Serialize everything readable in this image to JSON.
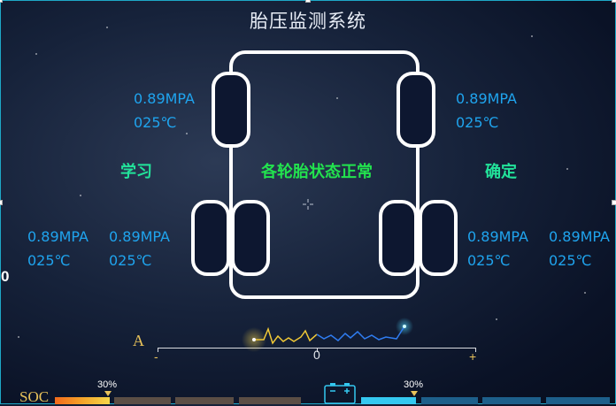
{
  "title": "胎压监测系统",
  "status": "各轮胎状态正常",
  "buttons": {
    "learn": "学习",
    "confirm": "确定"
  },
  "tires": {
    "front_left": {
      "pressure": "0.89MPA",
      "temp": "025℃"
    },
    "front_right": {
      "pressure": "0.89MPA",
      "temp": "025℃"
    },
    "rear_left_outer": {
      "pressure": "0.89MPA",
      "temp": "025℃"
    },
    "rear_left_inner": {
      "pressure": "0.89MPA",
      "temp": "025℃"
    },
    "rear_right_inner": {
      "pressure": "0.89MPA",
      "temp": "025℃"
    },
    "rear_right_outer": {
      "pressure": "0.89MPA",
      "temp": "025℃"
    }
  },
  "left_edge_digit": "0",
  "current_meter": {
    "label": "A",
    "minus": "-",
    "zero": "0",
    "plus": "+"
  },
  "soc": {
    "label": "SOC",
    "left_percent": "30%",
    "right_percent": "30%"
  },
  "colors": {
    "accent_cyan": "#1ea8c7",
    "reading_blue": "#1fa4ee",
    "status_green": "#22e34e",
    "button_green": "#22e39a",
    "gold": "#e8c25a"
  },
  "icons": [
    "crosshair-icon",
    "battery-icon"
  ]
}
